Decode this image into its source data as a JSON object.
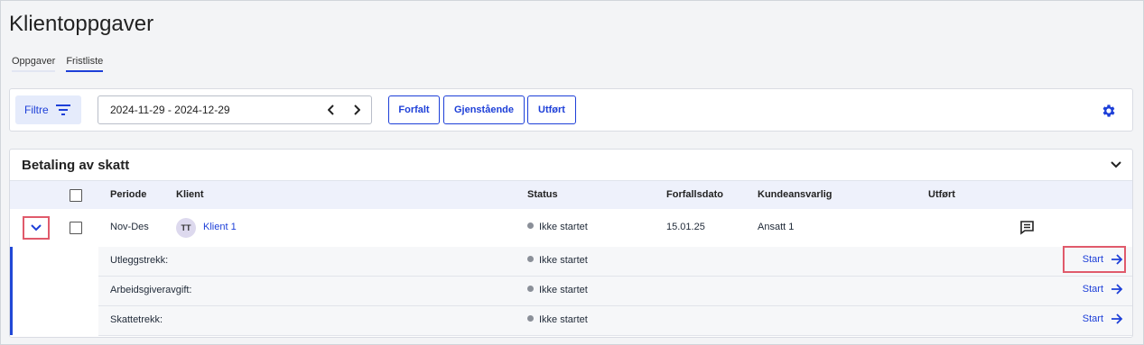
{
  "page": {
    "title": "Klientoppgaver"
  },
  "tabs": [
    {
      "label": "Oppgaver",
      "active": false
    },
    {
      "label": "Fristliste",
      "active": true
    }
  ],
  "toolbar": {
    "filter_label": "Filtre",
    "date_range": "2024-11-29 - 2024-12-29",
    "segments": [
      "Forfalt",
      "Gjenstående",
      "Utført"
    ],
    "settings_icon": "gear-icon"
  },
  "section": {
    "title": "Betaling av skatt",
    "columns": [
      "Periode",
      "Klient",
      "Status",
      "Forfallsdato",
      "Kundeansvarlig",
      "Utført"
    ],
    "row": {
      "periode": "Nov-Des",
      "avatar_initials": "TT",
      "klient": "Klient 1",
      "status": "Ikke startet",
      "forfallsdato": "15.01.25",
      "kundeansvarlig": "Ansatt 1"
    },
    "subtasks": [
      {
        "label": "Utleggstrekk:",
        "status": "Ikke startet",
        "action": "Start"
      },
      {
        "label": "Arbeidsgiveravgift:",
        "status": "Ikke startet",
        "action": "Start"
      },
      {
        "label": "Skattetrekk:",
        "status": "Ikke startet",
        "action": "Start"
      }
    ]
  },
  "colors": {
    "accent": "#1d3fd8",
    "highlight": "#e05a6b",
    "status_dot": "#8a8f98"
  }
}
